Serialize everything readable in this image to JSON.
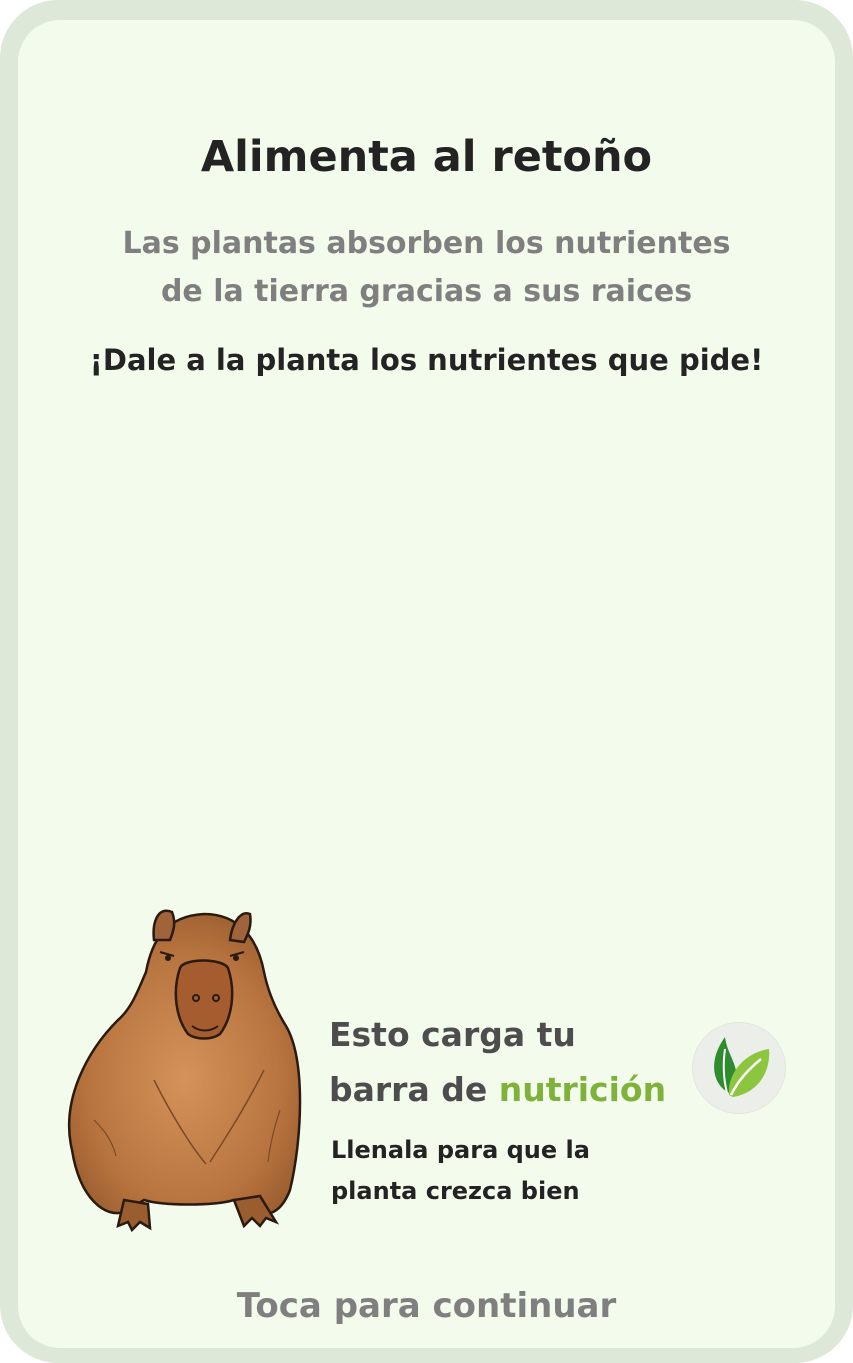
{
  "screen": {
    "title": "Alimenta al retoño",
    "subtitle_lines": [
      "Las plantas absorben los nutrientes",
      "de la tierra gracias a sus raices"
    ],
    "instruction": "¡Dale a la planta los nutrientes que pide!"
  },
  "info": {
    "title_line1": "Esto carga tu",
    "title_line2_prefix": "barra de ",
    "title_line2_accent": "nutrición",
    "description_lines": [
      "Llenala para que la",
      "planta crezca bien"
    ],
    "badge_icon": "leaf-icon"
  },
  "footer": {
    "continue_label": "Toca para continuar"
  },
  "colors": {
    "background": "#f3fcec",
    "frame": "#dde8d9",
    "accent": "#7fb23a",
    "leaf_dark": "#2e8b2e",
    "leaf_light": "#8cc63f"
  },
  "character": "capybara"
}
